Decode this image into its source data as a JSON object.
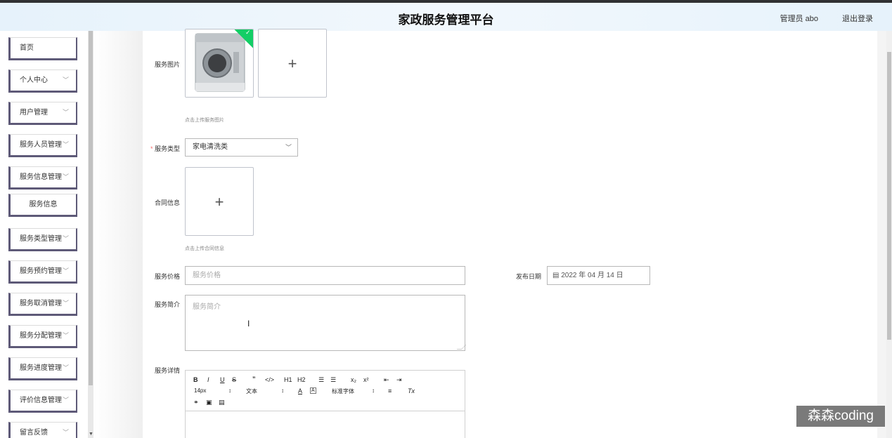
{
  "header": {
    "title": "家政服务管理平台",
    "user": "管理员 abo",
    "logout": "退出登录"
  },
  "sidebar": {
    "items": [
      {
        "label": "首页",
        "chevron": ""
      },
      {
        "label": "个人中心",
        "chevron": "﹀"
      },
      {
        "label": "用户管理",
        "chevron": "﹀"
      },
      {
        "label": "服务人员管理",
        "chevron": "﹀"
      },
      {
        "label": "服务信息管理",
        "chevron": "﹀"
      },
      {
        "label": "服务信息",
        "chevron": ""
      },
      {
        "label": "服务类型管理",
        "chevron": "﹀"
      },
      {
        "label": "服务预约管理",
        "chevron": "﹀"
      },
      {
        "label": "服务取消管理",
        "chevron": "﹀"
      },
      {
        "label": "服务分配管理",
        "chevron": "﹀"
      },
      {
        "label": "服务进度管理",
        "chevron": "﹀"
      },
      {
        "label": "评价信息管理",
        "chevron": "﹀"
      },
      {
        "label": "留言反馈",
        "chevron": "﹀"
      }
    ]
  },
  "form": {
    "image": {
      "label": "服务图片",
      "hint": "点击上传服务图片",
      "plus": "+"
    },
    "type": {
      "label": "服务类型",
      "required": "*",
      "value": "家电清洗类",
      "caret": "﹀"
    },
    "contract": {
      "label": "合同信息",
      "hint": "点击上传合同信息",
      "plus": "+"
    },
    "price": {
      "label": "服务价格",
      "placeholder": "服务价格"
    },
    "date": {
      "label": "发布日期",
      "icon": "▤",
      "value": "2022 年 04 月 14 日"
    },
    "intro": {
      "label": "服务简介",
      "placeholder": "服务简介"
    },
    "detail": {
      "label": "服务详情"
    }
  },
  "editor": {
    "row1": [
      "B",
      "I",
      "U",
      "S",
      "”",
      "</>",
      "H1",
      "H2",
      "☰",
      "☰",
      "x₂",
      "x²",
      "⇤",
      "⇥"
    ],
    "row2": [
      "14px",
      "↕",
      "文本",
      "↕",
      "A",
      "A",
      "标准字体",
      "↕",
      "≡",
      "Tx"
    ],
    "row3": [
      "⚭",
      "▣",
      "▤"
    ]
  },
  "cursor": "I",
  "watermark": "森森coding"
}
